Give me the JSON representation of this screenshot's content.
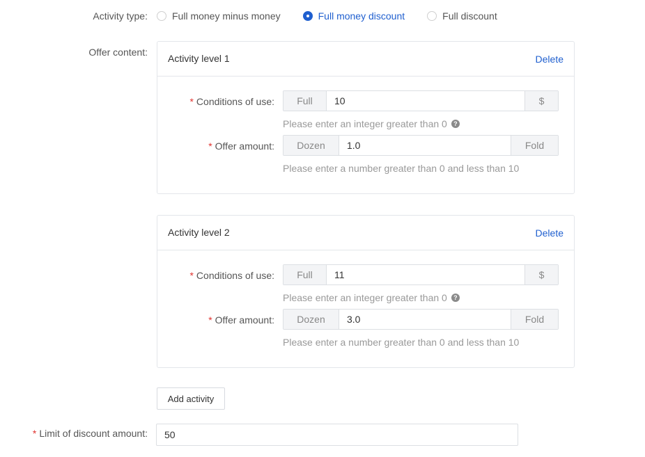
{
  "activity_type": {
    "label": "Activity type:",
    "options": [
      {
        "label": "Full money minus money",
        "checked": false
      },
      {
        "label": "Full money discount",
        "checked": true
      },
      {
        "label": "Full discount",
        "checked": false
      }
    ]
  },
  "offer_content": {
    "label": "Offer content:",
    "levels": [
      {
        "title": "Activity level 1",
        "delete_label": "Delete",
        "conditions": {
          "label": "Conditions of use:",
          "prefix": "Full",
          "value": "10",
          "suffix": "$",
          "hint": "Please enter an integer greater than 0"
        },
        "offer": {
          "label": "Offer amount:",
          "prefix": "Dozen",
          "value": "1.0",
          "suffix": "Fold",
          "hint": "Please enter a number greater than 0 and less than 10"
        }
      },
      {
        "title": "Activity level 2",
        "delete_label": "Delete",
        "conditions": {
          "label": "Conditions of use:",
          "prefix": "Full",
          "value": "11",
          "suffix": "$",
          "hint": "Please enter an integer greater than 0"
        },
        "offer": {
          "label": "Offer amount:",
          "prefix": "Dozen",
          "value": "3.0",
          "suffix": "Fold",
          "hint": "Please enter a number greater than 0 and less than 10"
        }
      }
    ]
  },
  "add_activity_label": "Add activity",
  "limit": {
    "label": "Limit of discount amount:",
    "value": "50"
  },
  "required_mark": "*",
  "help_icon_glyph": "?",
  "colors": {
    "accent": "#1f5fcf",
    "required": "#e0332f",
    "hint": "#999999",
    "border": "#e3e6ea"
  }
}
